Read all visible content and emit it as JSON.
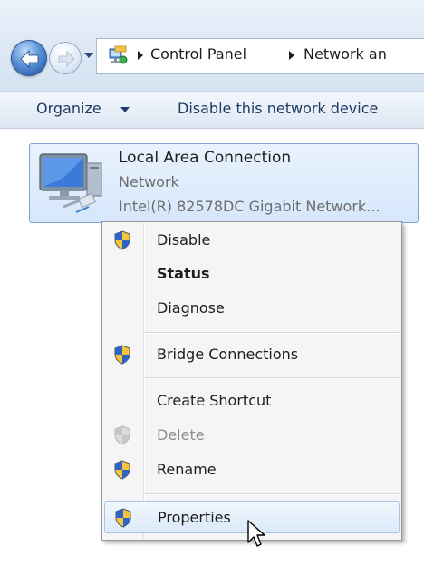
{
  "breadcrumb": {
    "items": [
      "Control Panel",
      "Network an"
    ]
  },
  "toolbar": {
    "organize_label": "Organize",
    "disable_label": "Disable this network device"
  },
  "connection": {
    "name": "Local Area Connection",
    "status": "Network",
    "adapter": "Intel(R) 82578DC Gigabit Network..."
  },
  "context_menu": {
    "items": [
      {
        "label": "Disable",
        "shield": true,
        "bold": false,
        "disabled": false
      },
      {
        "label": "Status",
        "shield": false,
        "bold": true,
        "disabled": false
      },
      {
        "label": "Diagnose",
        "shield": false,
        "bold": false,
        "disabled": false
      },
      {
        "label": "Bridge Connections",
        "shield": true,
        "bold": false,
        "disabled": false
      },
      {
        "label": "Create Shortcut",
        "shield": false,
        "bold": false,
        "disabled": false
      },
      {
        "label": "Delete",
        "shield": true,
        "bold": false,
        "disabled": true
      },
      {
        "label": "Rename",
        "shield": true,
        "bold": false,
        "disabled": false
      },
      {
        "label": "Properties",
        "shield": true,
        "bold": false,
        "disabled": false,
        "highlighted": true
      }
    ]
  },
  "icons": {
    "back": "back-arrow-icon",
    "forward": "forward-arrow-icon",
    "address": "network-folder-icon",
    "connection": "network-adapter-icon",
    "uac": "uac-shield-icon",
    "cursor": "mouse-pointer-icon"
  },
  "colors": {
    "selection_fill": "#d6e7fb",
    "selection_border": "#7da2ce",
    "menu_hover_border": "#a7c4e9",
    "toolbar_text": "#1e3c64"
  }
}
